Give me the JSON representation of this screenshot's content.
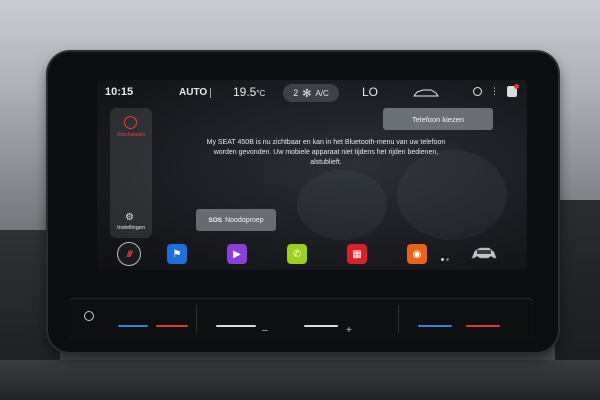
{
  "status_bar": {
    "time": "10:15",
    "climate_mode": "AUTO",
    "temp_left_value": "19.5",
    "temp_left_unit": "°C",
    "fan_speed": "2",
    "fan_icon": "fan-icon",
    "ac_label": "A/C",
    "temp_right": "LO"
  },
  "left_panel": {
    "warning_label": "Uitschakelen",
    "settings_label": "Instellingen"
  },
  "phone": {
    "choose_label": "Telefoon kiezen",
    "message": "My SEAT 450B is nu zichtbaar en kan in het Bluetooth-menu van uw telefoon worden gevonden. Uw mobiele apparaat niet tijdens het rijden bedienen, alstublieft."
  },
  "sos": {
    "tag": "SOS",
    "label": "Noodoproep"
  },
  "dock": {
    "home_label": "///",
    "apps": [
      {
        "name": "navigation",
        "icon": "flag-icon",
        "color": "#1e6fd9",
        "glyph": "⚑"
      },
      {
        "name": "media",
        "icon": "play-icon",
        "color": "#8b3fd6",
        "glyph": "▶"
      },
      {
        "name": "phone",
        "icon": "phone-icon",
        "color": "#9ccf1e",
        "glyph": "✆"
      },
      {
        "name": "apps",
        "icon": "grid-icon",
        "color": "#d8212b",
        "glyph": "▦"
      },
      {
        "name": "app-connect",
        "icon": "app-connect-icon",
        "color": "#e8641b",
        "glyph": "◉"
      }
    ]
  },
  "controls": {
    "minus_label": "–",
    "plus_label": "+"
  },
  "colors": {
    "accent_red": "#e0453f",
    "slider_blue": "#3d7fe0",
    "slider_red": "#e03a3a"
  }
}
